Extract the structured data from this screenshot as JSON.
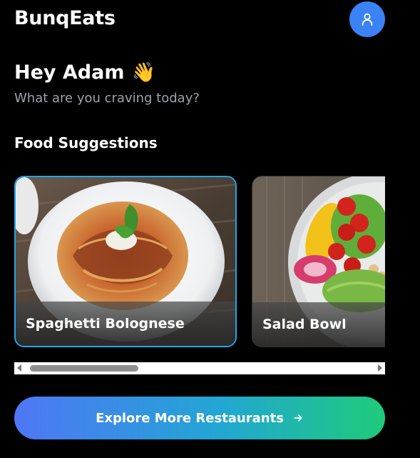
{
  "header": {
    "app_title": "BunqEats",
    "avatar_icon": "user-icon"
  },
  "greeting": {
    "text": "Hey Adam",
    "emoji": "👋",
    "subtitle": "What are you craving today?"
  },
  "suggestions": {
    "title": "Food Suggestions",
    "items": [
      {
        "label": "Spaghetti Bolognese",
        "selected": true
      },
      {
        "label": "Salad Bowl",
        "selected": false
      }
    ]
  },
  "cta": {
    "label": "Explore More Restaurants",
    "icon": "arrow-right-icon"
  },
  "colors": {
    "background": "#000000",
    "avatar": "#3b82f6",
    "selected_border": "#1ea7e8",
    "cta_gradient_start": "#4f76f6",
    "cta_gradient_end": "#1ecb7a"
  }
}
